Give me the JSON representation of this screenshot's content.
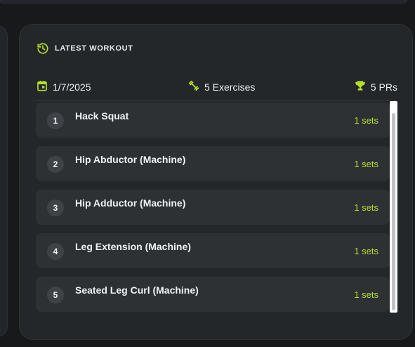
{
  "card": {
    "title": "LATEST WORKOUT",
    "header_icon": "history-icon"
  },
  "meta": {
    "date": "1/7/2025",
    "date_icon": "calendar-icon",
    "exercises": "5 Exercises",
    "exercises_icon": "dumbbell-icon",
    "prs": "5 PRs",
    "prs_icon": "trophy-icon"
  },
  "exercises": [
    {
      "number": "1",
      "name": "Hack Squat",
      "sets": "1 sets"
    },
    {
      "number": "2",
      "name": "Hip Abductor (Machine)",
      "sets": "1 sets"
    },
    {
      "number": "3",
      "name": "Hip Adductor (Machine)",
      "sets": "1 sets"
    },
    {
      "number": "4",
      "name": "Leg Extension (Machine)",
      "sets": "1 sets"
    },
    {
      "number": "5",
      "name": "Seated Leg Curl (Machine)",
      "sets": "1 sets"
    }
  ],
  "colors": {
    "accent": "#b4e02a",
    "background": "#17191a",
    "card": "#232729",
    "row": "#2d3134"
  }
}
